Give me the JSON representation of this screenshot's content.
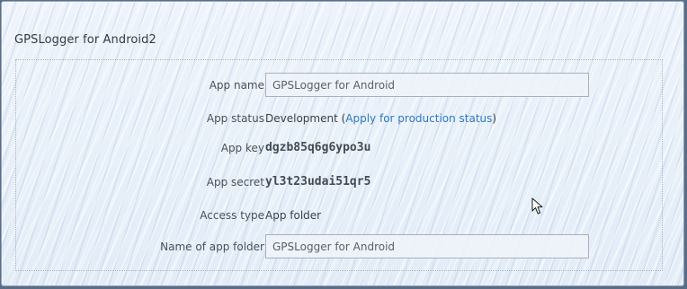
{
  "section": {
    "title": "GPSLogger for Android2"
  },
  "fields": {
    "app_name": {
      "label": "App name",
      "value": "GPSLogger for Android"
    },
    "app_status": {
      "label": "App status",
      "value_prefix": "Development (",
      "link_text": "Apply for production status",
      "value_suffix": ")"
    },
    "app_key": {
      "label": "App key",
      "value": "dgzb85q6g6ypo3u"
    },
    "app_secret": {
      "label": "App secret",
      "value": "yl3t23udai51qr5"
    },
    "access_type": {
      "label": "Access type",
      "value": "App folder"
    },
    "app_folder": {
      "label": "Name of app folder",
      "value": "GPSLogger for Android"
    }
  },
  "icons": {
    "cursor": "mouse-pointer-icon"
  }
}
